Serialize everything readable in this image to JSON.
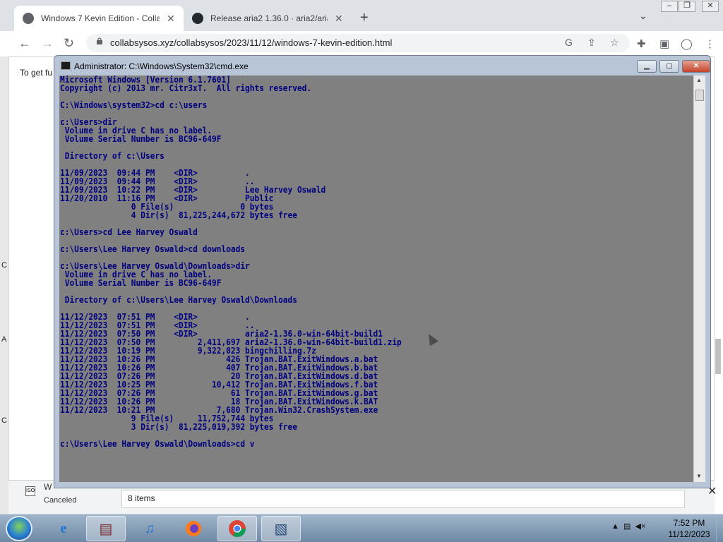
{
  "browser": {
    "tabs": [
      {
        "title": "Windows 7 Kevin Edition - Collab"
      },
      {
        "title": "Release aria2 1.36.0 · aria2/aria2"
      }
    ],
    "address": "collabsysos.xyz/collabsysos/2023/11/12/windows-7-kevin-edition.html",
    "page_text": "To get fu",
    "left_letters": [
      "C",
      "A",
      "C"
    ]
  },
  "cmd": {
    "title": "Administrator: C:\\Windows\\System32\\cmd.exe",
    "lines": [
      "Microsoft Windows [Version 6.1.7601]",
      "Copyright (c) 2013 mr. Citr3xT.  All rights reserved.",
      "",
      "C:\\Windows\\system32>cd c:\\users",
      "",
      "c:\\Users>dir",
      " Volume in drive C has no label.",
      " Volume Serial Number is BC96-649F",
      "",
      " Directory of c:\\Users",
      "",
      "11/09/2023  09:44 PM    <DIR>          .",
      "11/09/2023  09:44 PM    <DIR>          ..",
      "11/09/2023  10:22 PM    <DIR>          Lee Harvey Oswald",
      "11/20/2010  11:16 PM    <DIR>          Public",
      "               0 File(s)              0 bytes",
      "               4 Dir(s)  81,225,244,672 bytes free",
      "",
      "c:\\Users>cd Lee Harvey Oswald",
      "",
      "c:\\Users\\Lee Harvey Oswald>cd downloads",
      "",
      "c:\\Users\\Lee Harvey Oswald\\Downloads>dir",
      " Volume in drive C has no label.",
      " Volume Serial Number is BC96-649F",
      "",
      " Directory of c:\\Users\\Lee Harvey Oswald\\Downloads",
      "",
      "11/12/2023  07:51 PM    <DIR>          .",
      "11/12/2023  07:51 PM    <DIR>          ..",
      "11/12/2023  07:50 PM    <DIR>          aria2-1.36.0-win-64bit-build1",
      "11/12/2023  07:50 PM         2,411,697 aria2-1.36.0-win-64bit-build1.zip",
      "11/12/2023  10:19 PM         9,322,023 bingchilling.7z",
      "11/12/2023  10:26 PM               426 Trojan.BAT.ExitWindows.a.bat",
      "11/12/2023  10:26 PM               407 Trojan.BAT.ExitWindows.b.bat",
      "11/12/2023  07:26 PM                20 Trojan.BAT.ExitWindows.d.bat",
      "11/12/2023  10:25 PM            10,412 Trojan.BAT.ExitWindows.f.bat",
      "11/12/2023  07:26 PM                61 Trojan.BAT.ExitWindows.g.bat",
      "11/12/2023  10:26 PM                18 Trojan.BAT.ExitWindows.k.BAT",
      "11/12/2023  10:21 PM             7,680 Trojan.Win32.CrashSystem.exe",
      "               9 File(s)     11,752,744 bytes",
      "               3 Dir(s)  81,225,019,392 bytes free",
      "",
      "c:\\Users\\Lee Harvey Oswald\\Downloads>cd v"
    ],
    "colors": {
      "background": "#808080",
      "text": "#000080"
    }
  },
  "download_bar": {
    "item_name": "W",
    "item_status": "Canceled",
    "file_icon_text": "ISO"
  },
  "explorer_status": {
    "items": "8 items"
  },
  "taskbar": {
    "items": [
      "start-orb",
      "internet-explorer",
      "winrar",
      "itunes",
      "firefox",
      "chrome",
      "cmd"
    ],
    "clock_time": "7:52 PM",
    "clock_date": "11/12/2023"
  }
}
